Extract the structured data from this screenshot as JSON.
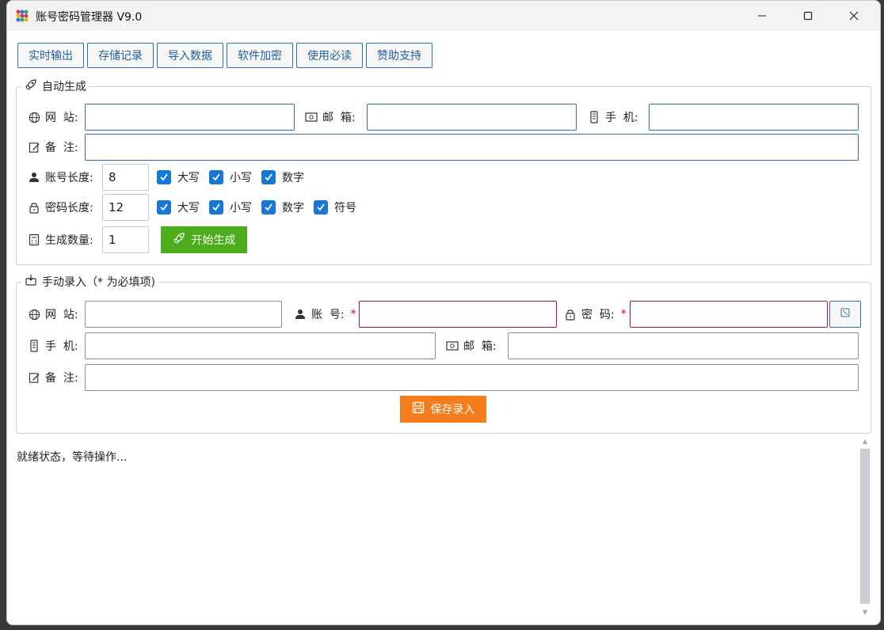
{
  "app": {
    "title": "账号密码管理器 V9.0"
  },
  "toolbar": [
    {
      "label": "实时输出"
    },
    {
      "label": "存储记录"
    },
    {
      "label": "导入数据"
    },
    {
      "label": "软件加密"
    },
    {
      "label": "使用必读"
    },
    {
      "label": "赞助支持"
    }
  ],
  "auto": {
    "title": "自动生成",
    "website_label": "网  站:",
    "email_label": "邮  箱:",
    "phone_label": "手  机:",
    "note_label": "备  注:",
    "account_length_label": "账号长度:",
    "account_length": "8",
    "account_options": [
      {
        "label": "大写"
      },
      {
        "label": "小写"
      },
      {
        "label": "数字"
      }
    ],
    "password_length_label": "密码长度:",
    "password_length": "12",
    "password_options": [
      {
        "label": "大写"
      },
      {
        "label": "小写"
      },
      {
        "label": "数字"
      },
      {
        "label": "符号"
      }
    ],
    "count_label": "生成数量:",
    "count": "1",
    "generate_button": "开始生成"
  },
  "manual": {
    "title": "手动录入（* 为必填项)",
    "website_label": "网  站:",
    "account_label": "账  号:",
    "password_label": "密  码:",
    "phone_label": "手  机:",
    "email_label": "邮  箱:",
    "note_label": "备  注:",
    "required_mark": "*",
    "save_button": "保存录入"
  },
  "status": {
    "text": "就绪状态，等待操作..."
  },
  "colors": {
    "accent": "#1677d4",
    "generate": "#4cad1b",
    "save": "#f77c1b",
    "required": "#c8002f"
  }
}
